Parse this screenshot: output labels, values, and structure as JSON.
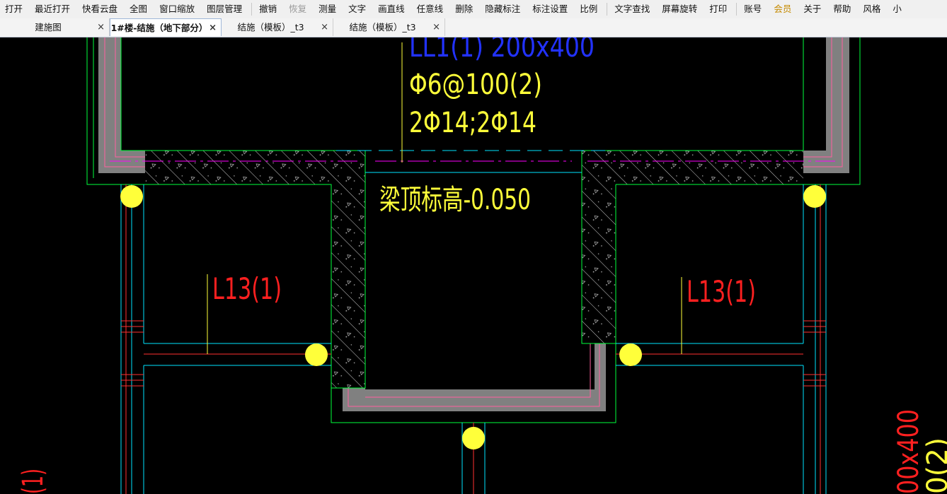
{
  "menubar": {
    "items": [
      {
        "label": "打开"
      },
      {
        "label": "最近打开"
      },
      {
        "label": "快看云盘"
      },
      {
        "label": "全图"
      },
      {
        "label": "窗口缩放"
      },
      {
        "label": "图层管理"
      },
      {
        "label": "撤销"
      },
      {
        "label": "恢复"
      },
      {
        "label": "测量"
      },
      {
        "label": "文字"
      },
      {
        "label": "画直线"
      },
      {
        "label": "任意线"
      },
      {
        "label": "删除"
      },
      {
        "label": "隐藏标注"
      },
      {
        "label": "标注设置"
      },
      {
        "label": "比例"
      },
      {
        "label": "文字查找"
      },
      {
        "label": "屏幕旋转"
      },
      {
        "label": "打印"
      },
      {
        "label": "账号"
      },
      {
        "label": "会员"
      },
      {
        "label": "关于"
      },
      {
        "label": "帮助"
      },
      {
        "label": "风格"
      },
      {
        "label": "小"
      }
    ]
  },
  "tabs": [
    {
      "label": "建施图",
      "close": "×"
    },
    {
      "label": "1#楼-结施（地下部分）",
      "close": "×"
    },
    {
      "label": "结施（模板）_t3",
      "close": "×"
    },
    {
      "label": "结施（模板）_t3",
      "close": "×"
    }
  ],
  "drawing": {
    "beam_label_top": "LL1(1) 200x400",
    "stirrup_label": "Φ6@100(2)",
    "rebar_label": "2Φ14;2Φ14",
    "elevation_label": "梁顶标高-0.050",
    "beam_left_label": "L13(1)",
    "beam_right_label": "L13(1)",
    "right_edge_label_1": "00x400",
    "right_edge_label_2": "0(2)",
    "left_edge_label": "(1)",
    "colors": {
      "background": "#000000",
      "wall_green": "#00ff3c",
      "cyan": "#00e5ff",
      "yellow_text": "#ffff3a",
      "blue_text": "#2232ff",
      "red_text": "#ff2020",
      "magenta": "#ff00ff",
      "fill_gray": "#808080"
    }
  }
}
